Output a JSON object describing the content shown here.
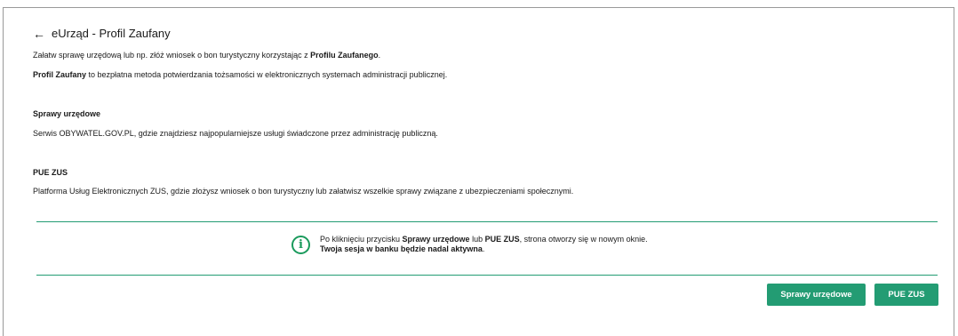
{
  "header": {
    "back_glyph": "←",
    "title": "eUrząd - Profil Zaufany"
  },
  "intro": {
    "line1_pre": "Załatw sprawę urzędową lub np. złóż wniosek o bon turystyczny korzystając z ",
    "line1_bold": "Profilu Zaufanego",
    "line1_post": ".",
    "line2_bold": "Profil Zaufany",
    "line2_post": " to bezpłatna metoda potwierdzania tożsamości w elektronicznych systemach administracji publicznej."
  },
  "sections": {
    "sprawy": {
      "heading": "Sprawy urzędowe",
      "text": "Serwis OBYWATEL.GOV.PL, gdzie znajdziesz najpopularniejsze usługi świadczone przez administrację publiczną."
    },
    "pue": {
      "heading": "PUE ZUS",
      "text": "Platforma Usług Elektronicznych ZUS, gdzie złożysz wniosek o bon turystyczny lub załatwisz wszelkie sprawy związane z ubezpieczeniami społecznymi."
    }
  },
  "info": {
    "icon_glyph": "i",
    "part1": "Po kliknięciu przycisku ",
    "bold1": "Sprawy urzędowe",
    "part2": " lub ",
    "bold2": "PUE ZUS",
    "part3": ", strona otworzy się w nowym oknie.",
    "line2_bold": "Twoja sesja w banku będzie nadal aktywna",
    "line2_post": "."
  },
  "buttons": {
    "sprawy_label": "Sprawy urzędowe",
    "pue_label": "PUE ZUS"
  },
  "colors": {
    "accent": "#239c73",
    "info_icon": "#1a9a5c"
  }
}
